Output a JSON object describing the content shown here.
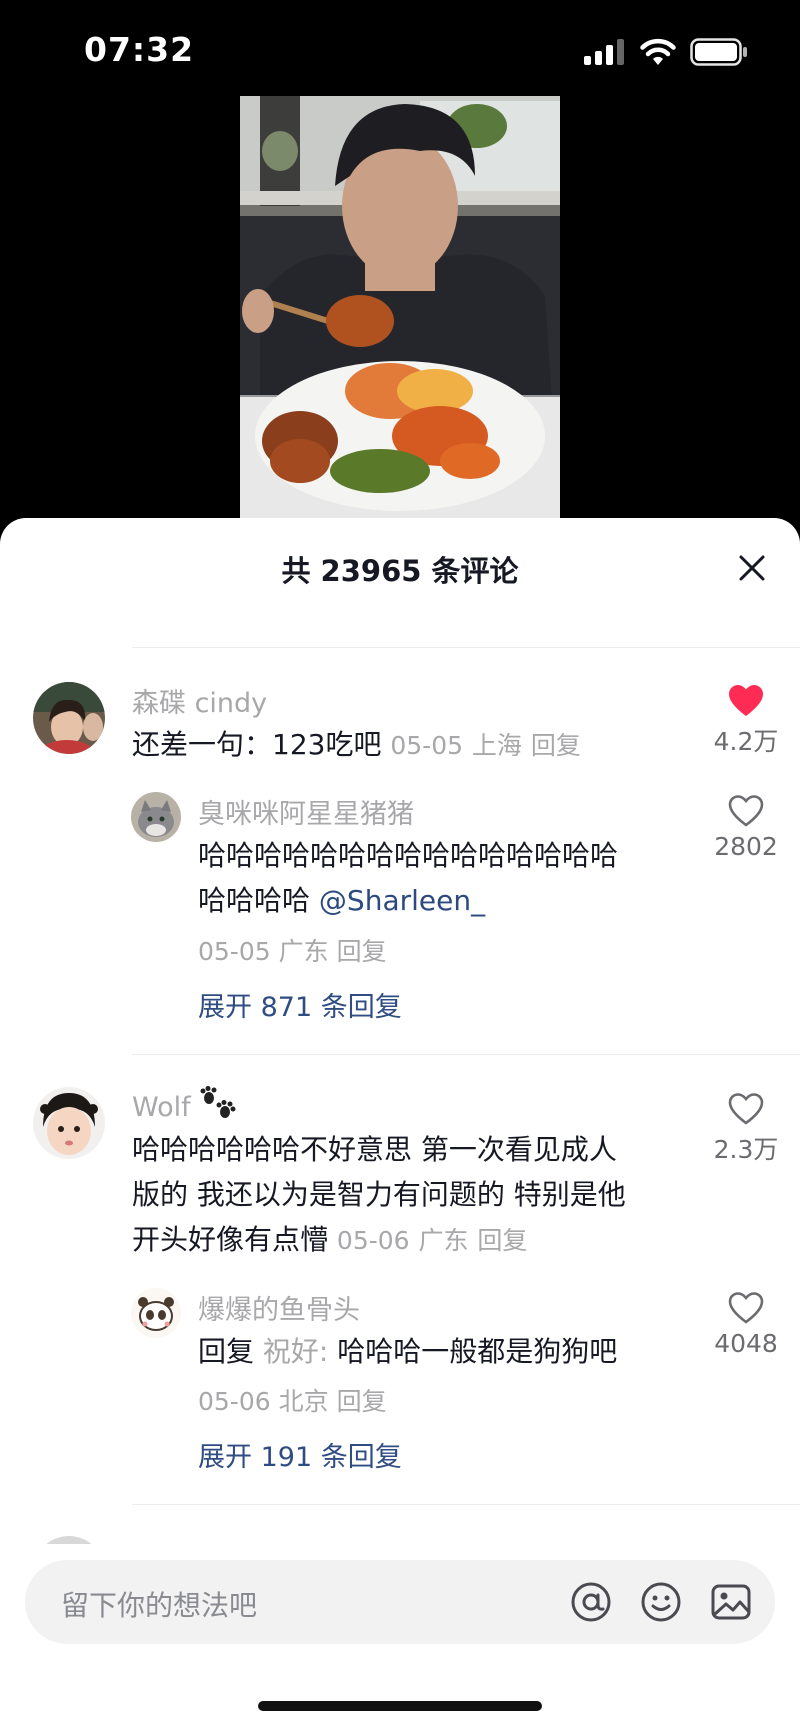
{
  "status": {
    "time": "07:32"
  },
  "sheet": {
    "title": "共 23965 条评论"
  },
  "comments": [
    {
      "name": "森碟 cindy",
      "text": "还差一句：123吃吧",
      "date": "05-05",
      "location": "上海",
      "reply_label": "回复",
      "likes": "4.2万",
      "liked": true,
      "reply": {
        "name": "臭咪咪阿星星猪猪",
        "text_line1": "哈哈哈哈哈哈哈哈哈哈哈哈哈哈哈",
        "text_line2": "哈哈哈哈",
        "mention": "@Sharleen_",
        "date": "05-05",
        "location": "广东",
        "reply_label": "回复",
        "likes": "2802"
      },
      "expand": "展开 871 条回复"
    },
    {
      "name": "Wolf",
      "text_line1": "哈哈哈哈哈哈不好意思 第一次看见成人",
      "text_line2": "版的 我还以为是智力有问题的 特别是他",
      "text_line3": "开头好像有点懵",
      "date": "05-06",
      "location": "广东",
      "reply_label": "回复",
      "likes": "2.3万",
      "liked": false,
      "reply": {
        "name": "爆爆的鱼骨头",
        "prefix": "回复",
        "reply_to": "祝好:",
        "text": "哈哈哈一般都是狗狗吧",
        "date": "05-06",
        "location": "北京",
        "reply_label": "回复",
        "likes": "4048"
      },
      "expand": "展开 191 条回复"
    }
  ],
  "input": {
    "placeholder": "留下你的想法吧"
  },
  "colors": {
    "like_red": "#fe2c55",
    "link_blue": "#2f4c83",
    "muted_gray": "#a8a8ab"
  }
}
